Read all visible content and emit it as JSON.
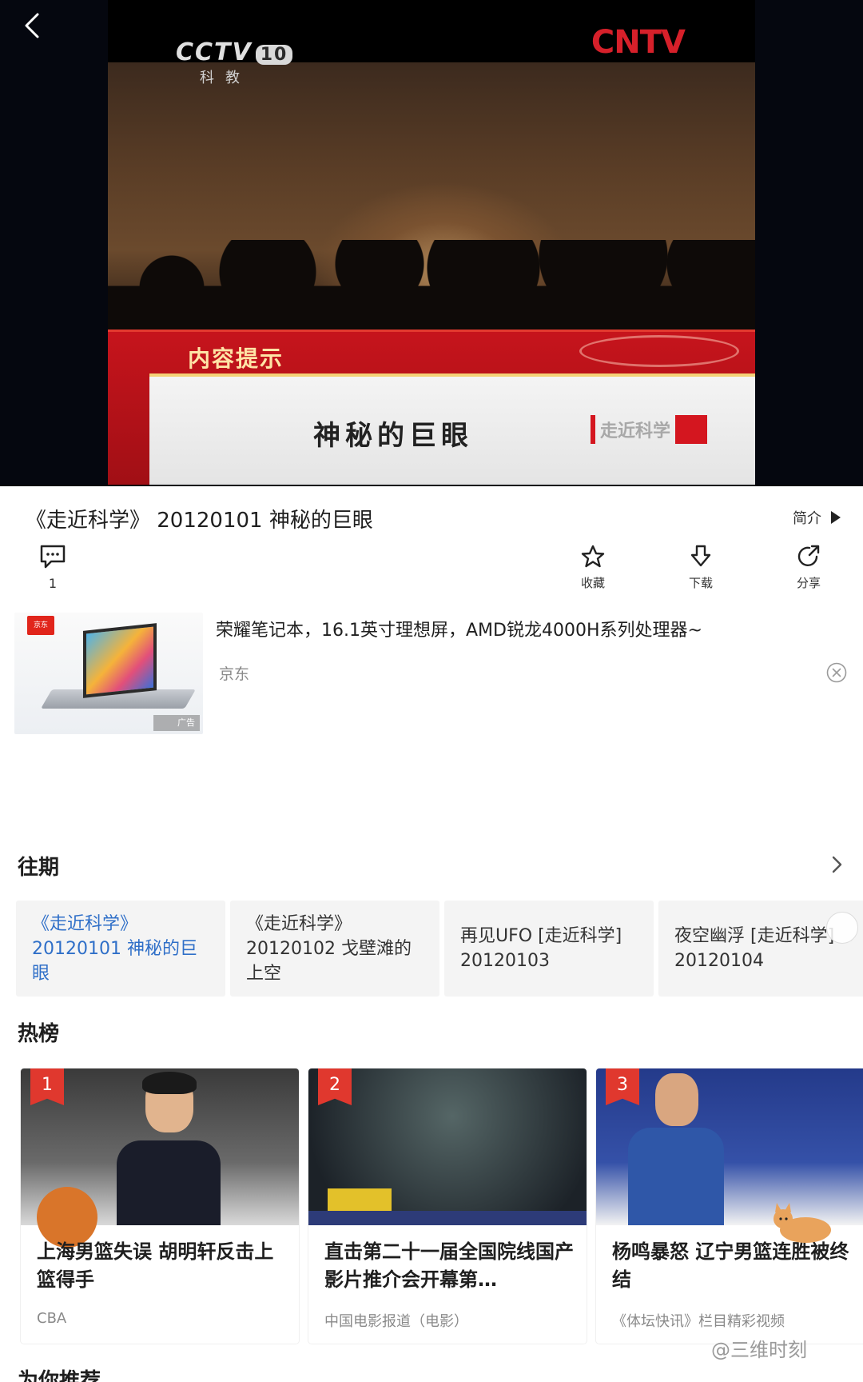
{
  "video": {
    "channel_logo": "CCTV",
    "channel_number": "10",
    "channel_sub": "科教",
    "network_logo": "CNTV",
    "banner_title": "内容提示",
    "episode_caption": "神秘的巨眼",
    "program_mark": "走近科学"
  },
  "details": {
    "title": "《走近科学》 20120101 神秘的巨眼",
    "intro_label": "简介",
    "comment_count": "1",
    "actions": [
      {
        "label": "收藏",
        "icon": "star-icon"
      },
      {
        "label": "下载",
        "icon": "download-icon"
      },
      {
        "label": "分享",
        "icon": "share-icon"
      }
    ]
  },
  "ad": {
    "title": "荣耀笔记本，16.1英寸理想屏，AMD锐龙4000H系列处理器~",
    "source": "京东",
    "badge": "京东",
    "tag": "广告"
  },
  "past_episodes": {
    "title": "往期",
    "items": [
      {
        "label": "《走近科学》20120101 神秘的巨眼",
        "active": true
      },
      {
        "label": "《走近科学》20120102 戈壁滩的上空",
        "active": false
      },
      {
        "label": "再见UFO [走近科学] 20120103",
        "active": false
      },
      {
        "label": "夜空幽浮 [走近科学] 20120104",
        "active": false
      }
    ]
  },
  "hot_list": {
    "title": "热榜",
    "items": [
      {
        "rank": "1",
        "title": "上海男篮失误 胡明轩反击上篮得手",
        "source": "CBA"
      },
      {
        "rank": "2",
        "title": "直击第二十一届全国院线国产影片推介会开幕第…",
        "source": "中国电影报道（电影）"
      },
      {
        "rank": "3",
        "title": "杨鸣暴怒 辽宁男篮连胜被终结",
        "source": "《体坛快讯》栏目精彩视频"
      }
    ]
  },
  "recommend": {
    "title": "为你推荐"
  },
  "watermark": "@三维时刻",
  "colors": {
    "accent_blue": "#2f6fc8",
    "rank_red": "#e0382e",
    "frame_blue": "#0e1f6e"
  }
}
